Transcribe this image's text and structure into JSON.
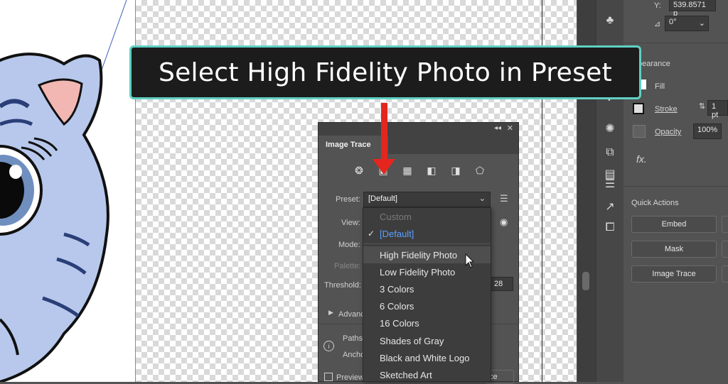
{
  "callout": {
    "text": "Select High Fidelity Photo in Preset"
  },
  "properties": {
    "y_label": "Y:",
    "y_value": "539.8571 p",
    "angle_value": "0°",
    "appearance_label": "pearance",
    "fill_label": "Fill",
    "stroke_label": "Stroke",
    "stroke_value": "1 pt",
    "opacity_label": "Opacity",
    "opacity_value": "100%",
    "fx_label": "fx.",
    "quick_actions_title": "Quick Actions",
    "buttons": [
      "Embed",
      "Mask",
      "Image Trace"
    ]
  },
  "image_trace": {
    "title": "Image Trace",
    "preset_label": "Preset:",
    "preset_value": "[Default]",
    "view_label": "View:",
    "mode_label": "Mode:",
    "palette_label": "Palette:",
    "threshold_label": "Threshold:",
    "threshold_value": "28",
    "advanced_label": "Advanc",
    "paths_label": "Paths",
    "anchors_label": "Ancho",
    "preview_label": "Preview",
    "trace_button_stub": "ce"
  },
  "preset_options": [
    {
      "label": "Custom",
      "state": "disabled"
    },
    {
      "label": "[Default]",
      "state": "selected"
    },
    {
      "label": "High Fidelity Photo",
      "state": "hover"
    },
    {
      "label": "Low Fidelity Photo",
      "state": "normal"
    },
    {
      "label": "3 Colors",
      "state": "normal"
    },
    {
      "label": "6 Colors",
      "state": "normal"
    },
    {
      "label": "16 Colors",
      "state": "normal"
    },
    {
      "label": "Shades of Gray",
      "state": "normal"
    },
    {
      "label": "Black and White Logo",
      "state": "normal"
    },
    {
      "label": "Sketched Art",
      "state": "normal"
    }
  ],
  "colors": {
    "callout_border": "#5fd0c3",
    "arrow": "#e4261e",
    "selected_option": "#5aa0ff"
  }
}
